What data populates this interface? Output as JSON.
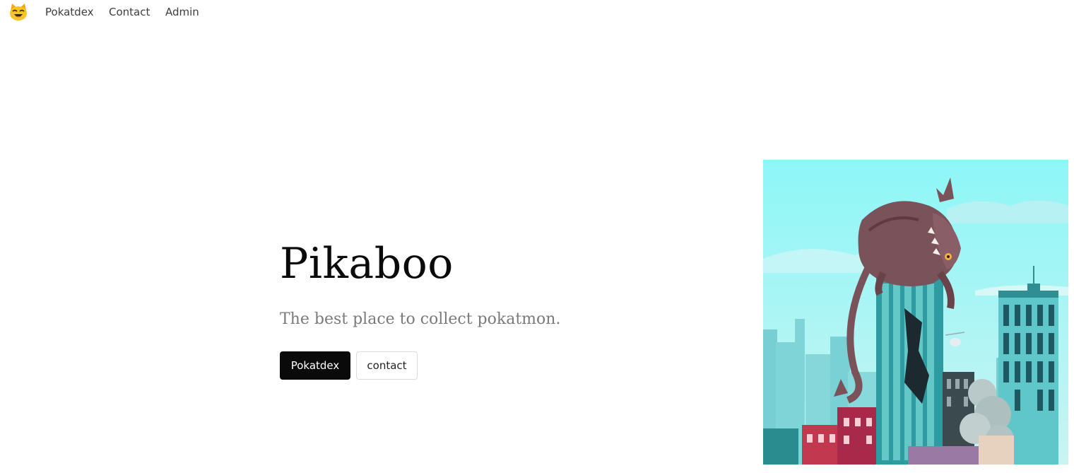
{
  "nav": {
    "logo": "cat-face-icon",
    "links": [
      "Pokatdex",
      "Contact",
      "Admin"
    ]
  },
  "hero": {
    "title": "Pikaboo",
    "subtitle": "The best place to collect pokatmon.",
    "primary_button": "Pokatdex",
    "secondary_button": "contact",
    "image": "monster-on-skyscraper-illustration"
  },
  "colors": {
    "primary_button_bg": "#0a0a0a",
    "subtitle_text": "#7a7a7a",
    "sky": "#8ef0f2"
  }
}
